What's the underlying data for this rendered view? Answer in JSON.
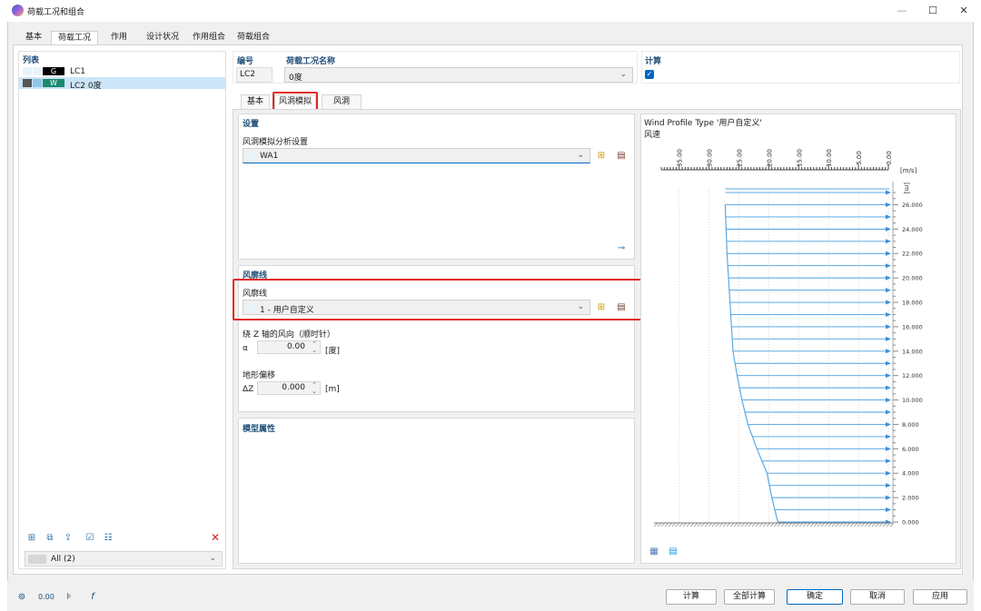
{
  "window": {
    "title": "荷载工况和组合"
  },
  "main_tabs": [
    {
      "label": "基本"
    },
    {
      "label": "荷载工况"
    },
    {
      "label": "作用"
    },
    {
      "label": "设计状况"
    },
    {
      "label": "作用组合"
    },
    {
      "label": "荷载组合"
    }
  ],
  "list": {
    "header": "列表",
    "items": [
      {
        "badge": "G",
        "label": "LC1",
        "badge_color": "#000000"
      },
      {
        "badge": "W",
        "label": "LC2 0度",
        "badge_color": "#1a8a6e"
      }
    ],
    "filter_value": "All (2)"
  },
  "fields": {
    "number_label": "编号",
    "number_value": "LC2",
    "name_label": "荷载工况名称",
    "name_value": "0度",
    "calc_label": "计算"
  },
  "sub_tabs": [
    {
      "label": "基本"
    },
    {
      "label": "风洞模拟"
    },
    {
      "label": "风洞"
    }
  ],
  "settings": {
    "header": "设置",
    "analysis_label": "风洞模拟分析设置",
    "analysis_value": "WA1"
  },
  "wind_profile": {
    "header": "风廓线",
    "label": "风廓线",
    "value": "1 - 用户自定义",
    "direction_label": "绕 Z 轴的风向（顺时针）",
    "alpha_symbol": "α",
    "alpha_value": "0.00",
    "alpha_unit": "[度]",
    "terrain_label": "地形偏移",
    "dz_symbol": "ΔZ",
    "dz_value": "0.000",
    "dz_unit": "[m]"
  },
  "model_props": {
    "header": "模型属性"
  },
  "chart_data": {
    "type": "line",
    "title": "Wind Profile Type '用户自定义'",
    "subtitle": "风速",
    "x_unit": "[m/s]",
    "y_unit": "[m]",
    "x_ticks": [
      "35.00",
      "30.00",
      "25.00",
      "20.00",
      "15.00",
      "10.00",
      "5.00",
      "0.00"
    ],
    "y_ticks": [
      "26.000",
      "24.000",
      "22.000",
      "20.000",
      "18.000",
      "16.000",
      "14.000",
      "12.000",
      "10.000",
      "8.000",
      "6.000",
      "4.000",
      "2.000",
      "0.000"
    ],
    "xlim": [
      0,
      38
    ],
    "ylim": [
      0,
      27.3
    ],
    "series": [
      {
        "x": [
          18.5,
          19.5,
          20.3,
          22.0,
          23.5,
          24.5,
          25.3,
          26.0,
          26.5,
          27.0,
          27.3
        ],
        "y": [
          0,
          2,
          4,
          6,
          8,
          10,
          12,
          14,
          18,
          22,
          26
        ]
      }
    ]
  },
  "footer": {
    "calc": "计算",
    "calc_all": "全部计算",
    "ok": "确定",
    "cancel": "取消",
    "apply": "应用"
  }
}
